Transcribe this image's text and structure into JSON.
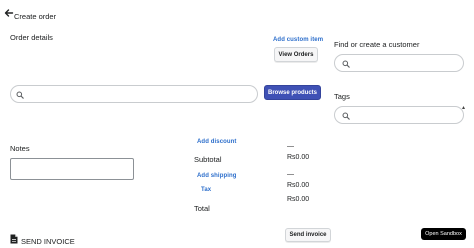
{
  "header": {
    "title": "Create order"
  },
  "order_details": {
    "label": "Order details",
    "add_custom_item": "Add custom item",
    "view_orders": "View Orders",
    "browse_products": "Browse products"
  },
  "customer": {
    "label": "Find or create a customer"
  },
  "tags": {
    "label": "Tags"
  },
  "notes": {
    "label": "Notes"
  },
  "summary": {
    "add_discount": "Add discount",
    "discount_value": "—",
    "subtotal_label": "Subtotal",
    "subtotal_value": "Rs0.00",
    "add_shipping": "Add shipping",
    "shipping_value": "—",
    "shipping_amount": "Rs0.00",
    "tax_label": "Tax",
    "tax_value": "Rs0.00",
    "total_label": "Total"
  },
  "footer": {
    "send_invoice_label": "SEND INVOICE",
    "send_invoice_button": "Send invoice",
    "open_sandbox": "Open Sandbox"
  },
  "colors": {
    "primary": "#3f51b5",
    "link": "#2c6ecb"
  }
}
